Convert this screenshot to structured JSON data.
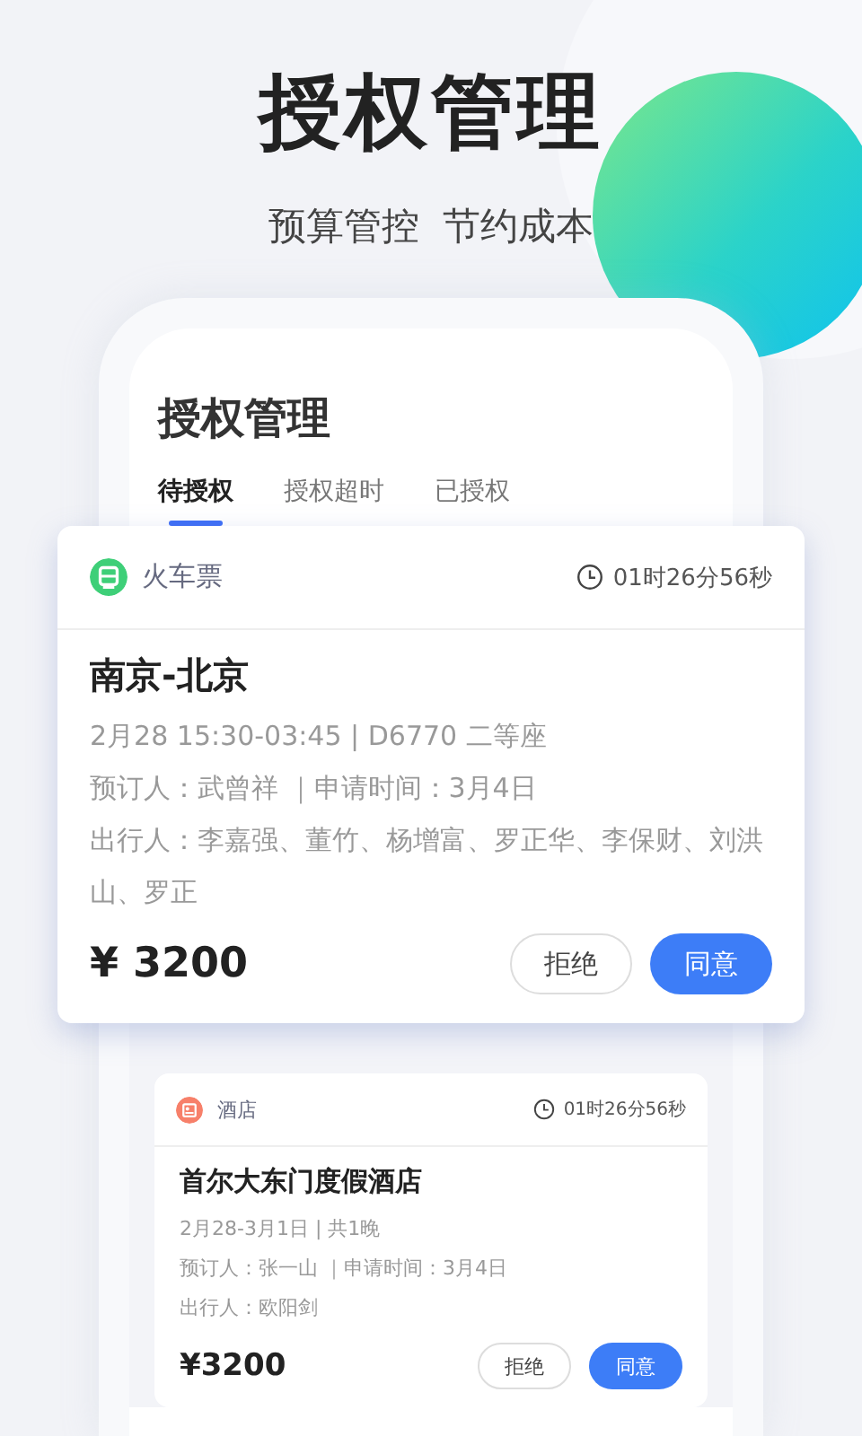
{
  "header": {
    "title": "授权管理",
    "subtitle": "预算管控  节约成本"
  },
  "screen": {
    "title": "授权管理",
    "tabs": [
      {
        "label": "待授权",
        "selected": true
      },
      {
        "label": "授权超时",
        "selected": false
      },
      {
        "label": "已授权",
        "selected": false
      }
    ]
  },
  "requests": [
    {
      "kind": "train",
      "category": "火车票",
      "countdown": "01时26分56秒",
      "title": "南京-北京",
      "details": [
        "2月28 15:30-03:45 | D6770 二等座",
        "预订人：武曾祥 ｜申请时间：3月4日",
        "出行人：李嘉强、董竹、杨增富、罗正华、李保财、刘洪山、罗正"
      ],
      "price": "¥ 3200",
      "reject": "拒绝",
      "approve": "同意"
    },
    {
      "kind": "hotel",
      "category": "酒店",
      "countdown": "01时26分56秒",
      "title": "首尔大东门度假酒店",
      "details": [
        "2月28-3月1日 | 共1晚",
        "预订人：张一山 ｜申请时间：3月4日",
        "出行人：欧阳剑"
      ],
      "price": "¥3200",
      "reject": "拒绝",
      "approve": "同意"
    }
  ]
}
